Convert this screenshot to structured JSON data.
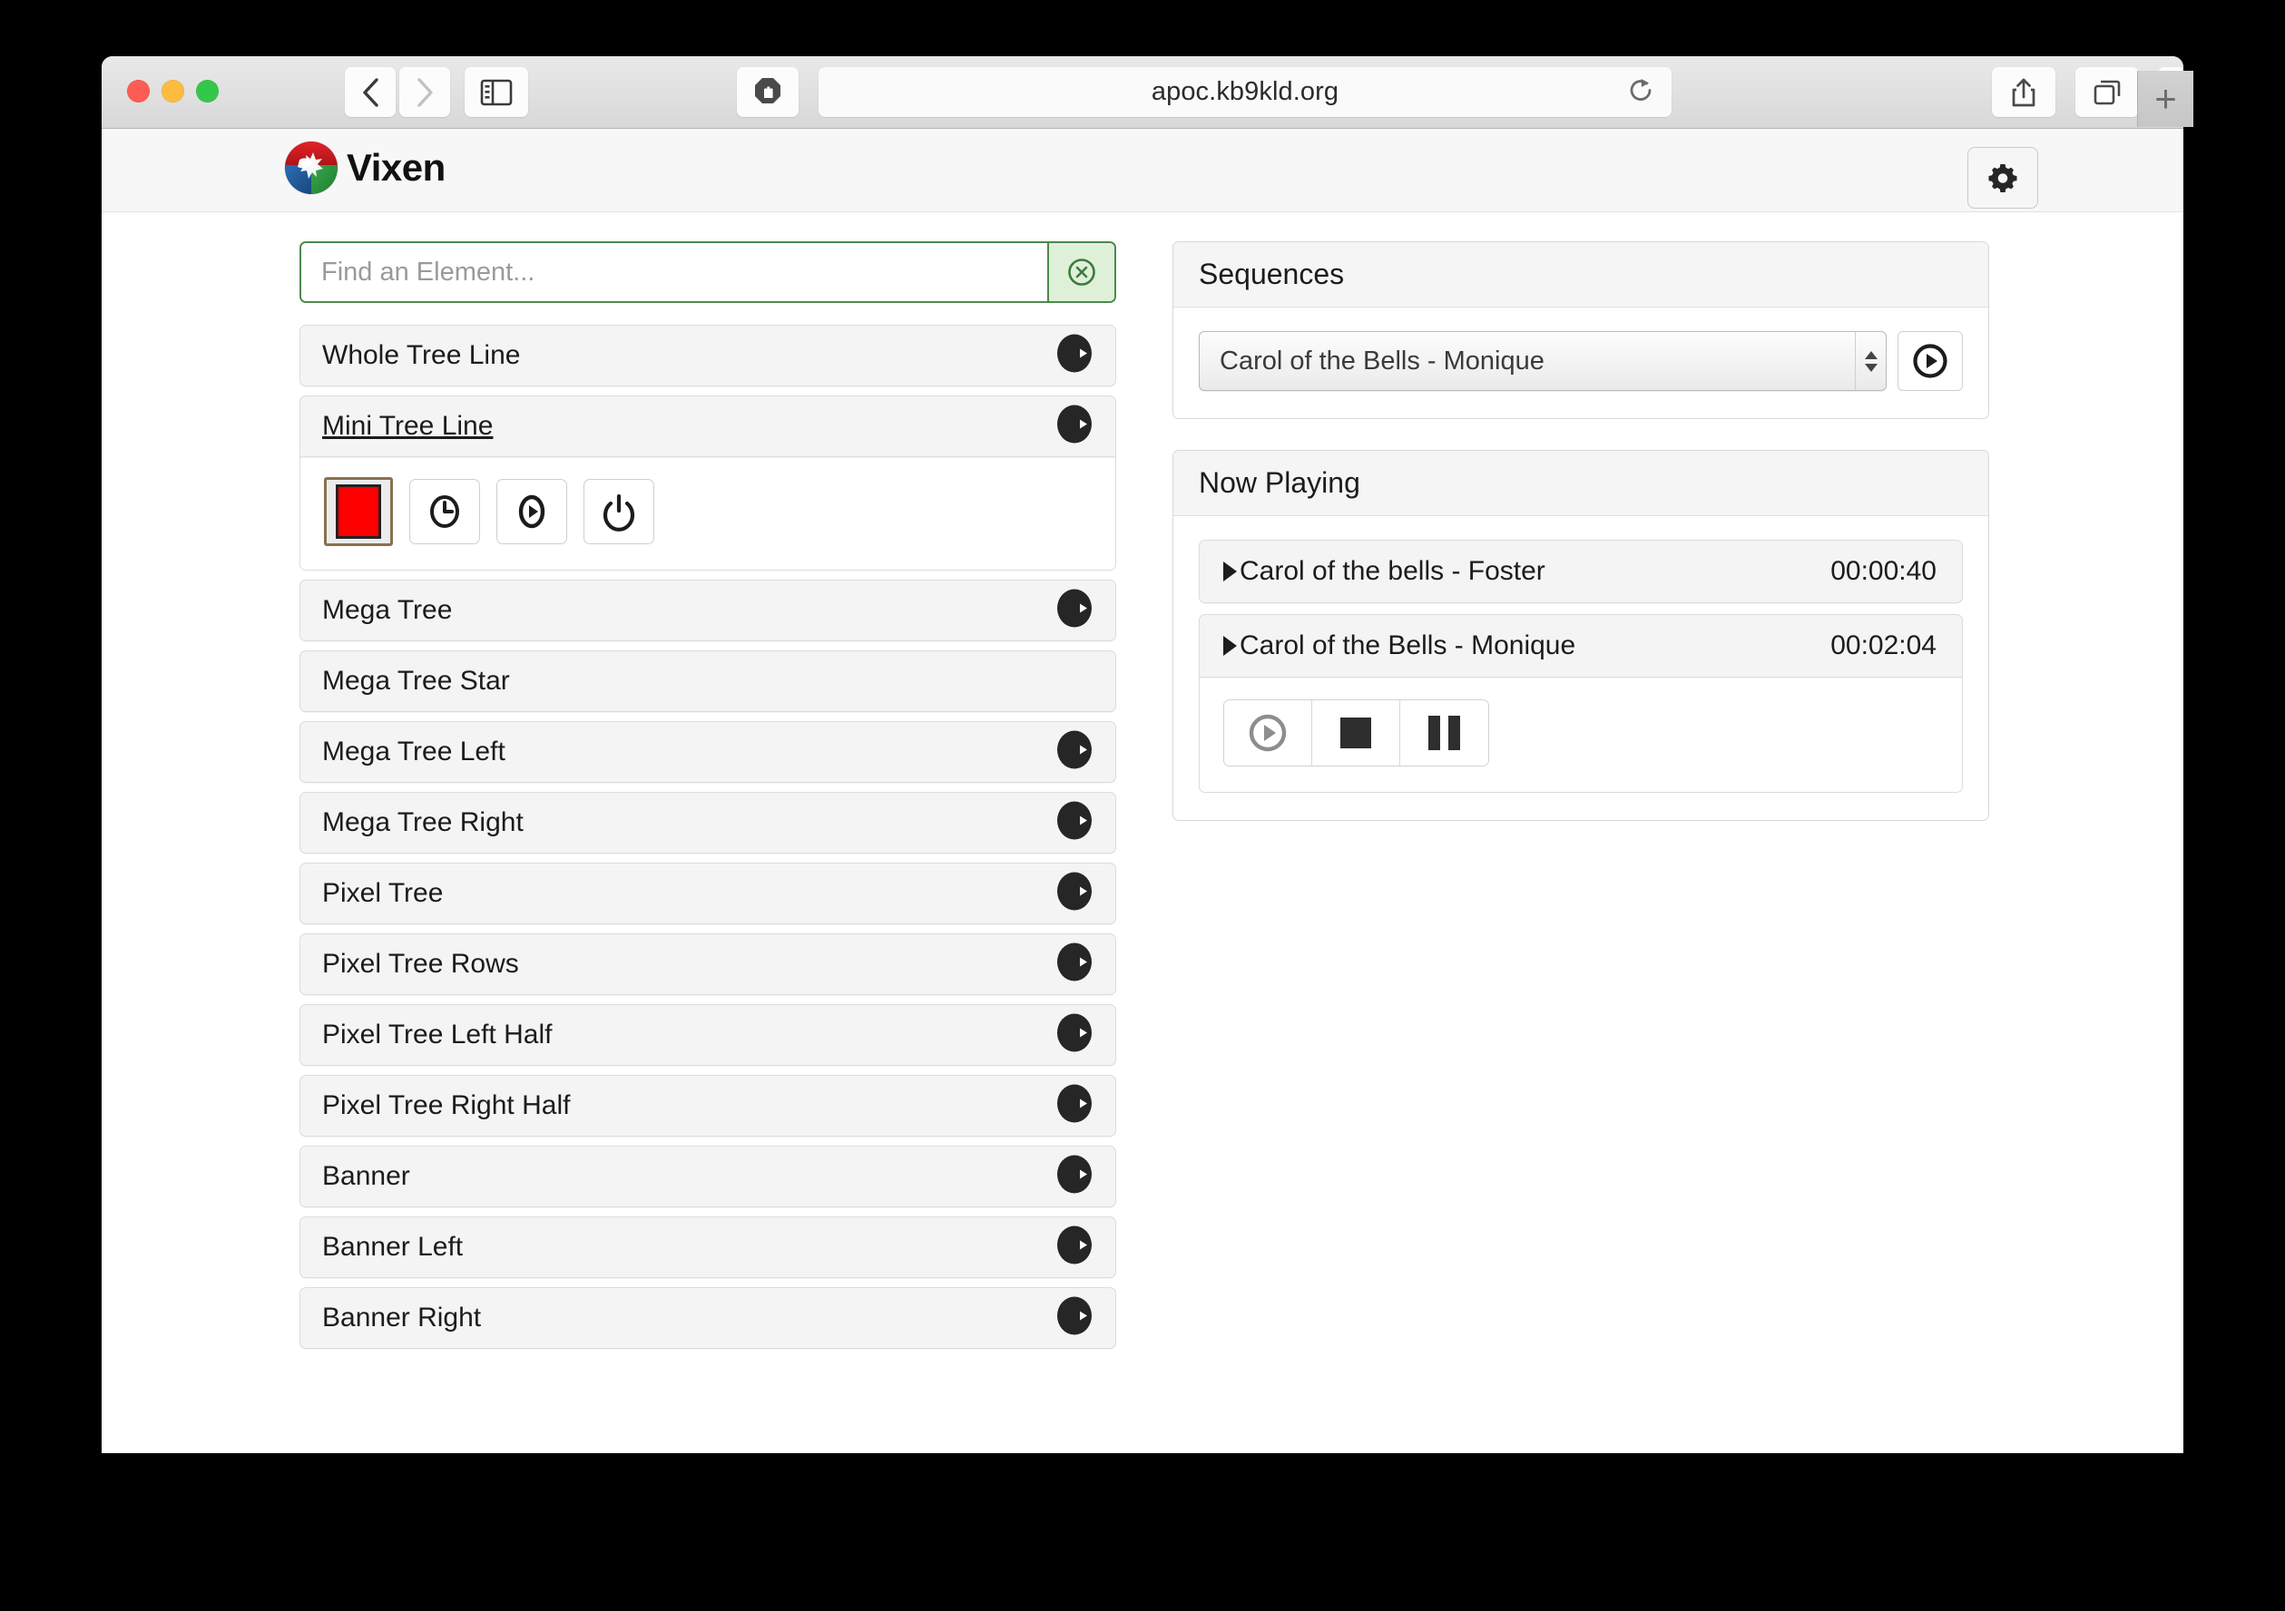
{
  "browser": {
    "url": "apoc.kb9kld.org",
    "back_icon": "back-chevron-icon",
    "forward_icon": "forward-chevron-icon",
    "sidebar_icon": "sidebar-toggle-icon",
    "shield_icon": "content-blocker-icon",
    "reload_icon": "reload-icon",
    "share_icon": "share-icon",
    "tabs_icon": "tab-overview-icon",
    "downloads_icon": "downloads-icon",
    "new_tab_label": "+"
  },
  "header": {
    "brand": "Vixen",
    "logo_icon": "vixen-globe-reindeer-logo",
    "gear_icon": "gear-icon"
  },
  "search": {
    "placeholder": "Find an Element...",
    "value": "",
    "clear_icon": "clear-circle-x-icon",
    "border_color": "#4a8a4a",
    "clear_bg_color": "#dff0d8"
  },
  "elements": [
    {
      "label": "Whole Tree Line",
      "has_arrow": true,
      "selected": false,
      "expanded": false
    },
    {
      "label": "Mini Tree Line",
      "has_arrow": true,
      "selected": true,
      "expanded": true
    },
    {
      "label": "Mega Tree",
      "has_arrow": true,
      "selected": false,
      "expanded": false
    },
    {
      "label": "Mega Tree Star",
      "has_arrow": false,
      "selected": false,
      "expanded": false
    },
    {
      "label": "Mega Tree Left",
      "has_arrow": true,
      "selected": false,
      "expanded": false
    },
    {
      "label": "Mega Tree Right",
      "has_arrow": true,
      "selected": false,
      "expanded": false
    },
    {
      "label": "Pixel Tree",
      "has_arrow": true,
      "selected": false,
      "expanded": false
    },
    {
      "label": "Pixel Tree Rows",
      "has_arrow": true,
      "selected": false,
      "expanded": false
    },
    {
      "label": "Pixel Tree Left Half",
      "has_arrow": true,
      "selected": false,
      "expanded": false
    },
    {
      "label": "Pixel Tree Right Half",
      "has_arrow": true,
      "selected": false,
      "expanded": false
    },
    {
      "label": "Banner",
      "has_arrow": true,
      "selected": false,
      "expanded": false
    },
    {
      "label": "Banner Left",
      "has_arrow": true,
      "selected": false,
      "expanded": false
    },
    {
      "label": "Banner Right",
      "has_arrow": true,
      "selected": false,
      "expanded": false
    }
  ],
  "element_detail": {
    "color_value": "#FF0000",
    "swatch_border_color": "#8a6f50",
    "buttons": [
      {
        "icon": "clock-icon"
      },
      {
        "icon": "play-circle-icon"
      },
      {
        "icon": "power-icon"
      }
    ]
  },
  "sequences": {
    "title": "Sequences",
    "selected": "Carol of the Bells - Monique",
    "play_icon": "play-circle-icon"
  },
  "now_playing": {
    "title": "Now Playing",
    "items": [
      {
        "caret": "caret-right-icon",
        "title": "Carol of the bells - Foster",
        "time": "00:00:40",
        "active": false
      },
      {
        "caret": "caret-right-icon",
        "title": "Carol of the Bells - Monique",
        "time": "00:02:04",
        "active": true
      }
    ],
    "controls": [
      {
        "icon": "play-circle-icon",
        "state": "disabled"
      },
      {
        "icon": "stop-icon",
        "state": "enabled"
      },
      {
        "icon": "pause-icon",
        "state": "enabled"
      }
    ]
  }
}
